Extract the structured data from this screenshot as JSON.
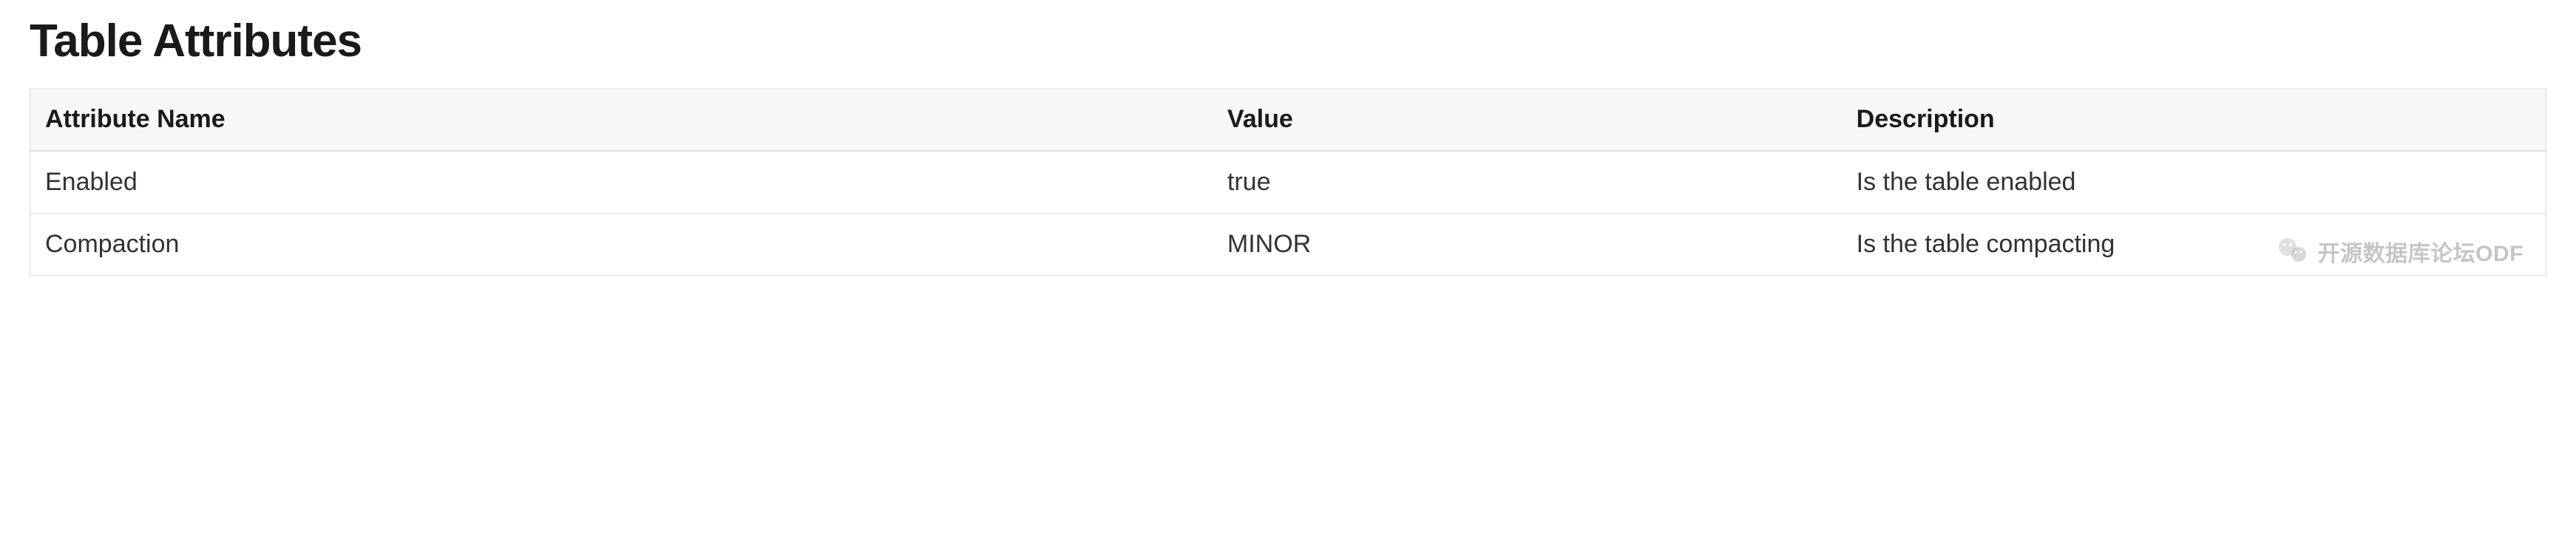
{
  "header": {
    "title": "Table Attributes"
  },
  "table": {
    "columns": {
      "name": "Attribute Name",
      "value": "Value",
      "description": "Description"
    },
    "rows": [
      {
        "name": "Enabled",
        "value": "true",
        "description": "Is the table enabled"
      },
      {
        "name": "Compaction",
        "value": "MINOR",
        "description": "Is the table compacting"
      }
    ]
  },
  "watermark": {
    "label": "开源数据库论坛ODF"
  }
}
